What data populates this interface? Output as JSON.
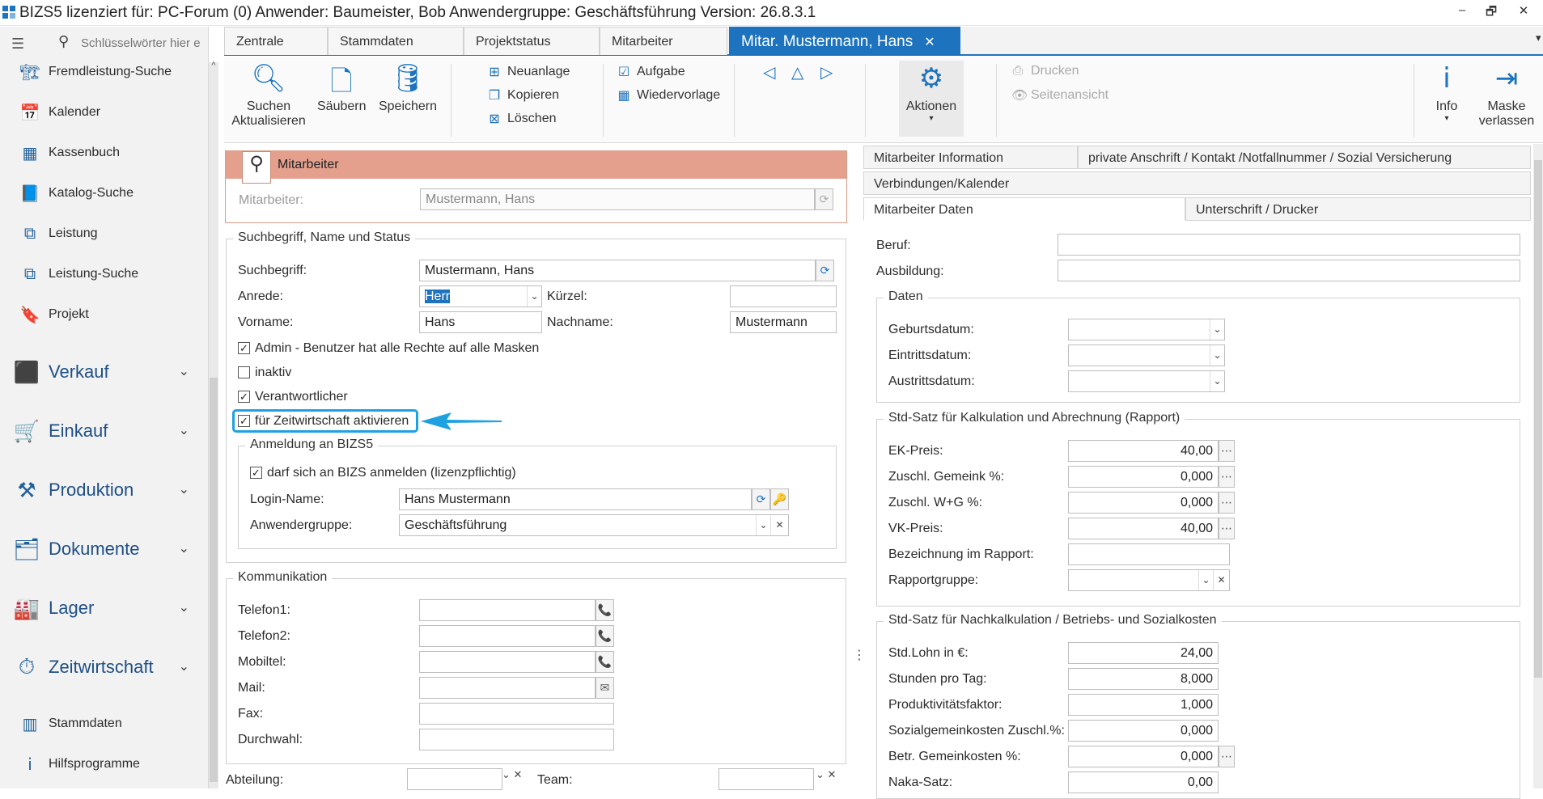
{
  "titlebar": {
    "text": "BIZS5  lizenziert für: PC-Forum (0)  Anwender: Baumeister, Bob  Anwendergruppe: Geschäftsführung   Version: 26.8.3.1"
  },
  "search": {
    "placeholder": "Schlüsselwörter hier e"
  },
  "sidebar": {
    "items": [
      {
        "label": "Fremdleistung-Suche",
        "icon": "crane-icon"
      },
      {
        "label": "Kalender",
        "icon": "calendar-icon"
      },
      {
        "label": "Kassenbuch",
        "icon": "cashbook-icon"
      },
      {
        "label": "Katalog-Suche",
        "icon": "catalog-icon"
      },
      {
        "label": "Leistung",
        "icon": "service-icon"
      },
      {
        "label": "Leistung-Suche",
        "icon": "service-search-icon"
      },
      {
        "label": "Projekt",
        "icon": "project-icon"
      }
    ],
    "groups": [
      {
        "label": "Verkauf"
      },
      {
        "label": "Einkauf"
      },
      {
        "label": "Produktion"
      },
      {
        "label": "Dokumente"
      },
      {
        "label": "Lager"
      },
      {
        "label": "Zeitwirtschaft"
      }
    ],
    "bottom": [
      {
        "label": "Stammdaten"
      },
      {
        "label": "Hilfsprogramme"
      }
    ]
  },
  "tabs": [
    {
      "label": "Zentrale"
    },
    {
      "label": "Stammdaten"
    },
    {
      "label": "Projektstatus"
    },
    {
      "label": "Mitarbeiter"
    },
    {
      "label": "Mitar. Mustermann, Hans"
    }
  ],
  "ribbon": {
    "suchen": "Suchen",
    "aktualisieren": "Aktualisieren",
    "saeubern": "Säubern",
    "speichern": "Speichern",
    "neuanlage": "Neuanlage",
    "kopieren": "Kopieren",
    "loeschen": "Löschen",
    "aufgabe": "Aufgabe",
    "wiedervorlage": "Wiedervorlage",
    "aktionen": "Aktionen",
    "drucken": "Drucken",
    "seitenansicht": "Seitenansicht",
    "info": "Info",
    "maske": "Maske",
    "verlassen": "verlassen"
  },
  "header": {
    "title": "Mitarbeiter",
    "mitarbeiter_label": "Mitarbeiter:",
    "mitarbeiter_value": "Mustermann, Hans"
  },
  "name_group": {
    "title": "Suchbegriff, Name und Status",
    "suchbegriff_label": "Suchbegriff:",
    "suchbegriff": "Mustermann, Hans",
    "anrede_label": "Anrede:",
    "anrede": "Herr",
    "kuerzel_label": "Kürzel:",
    "kuerzel": "",
    "vorname_label": "Vorname:",
    "vorname": "Hans",
    "nachname_label": "Nachname:",
    "nachname": "Mustermann",
    "cb_admin": "Admin - Benutzer hat alle Rechte auf alle Masken",
    "cb_inaktiv": "inaktiv",
    "cb_verantw": "Verantwortlicher",
    "cb_zeit": "für Zeitwirtschaft aktivieren"
  },
  "anmeldung": {
    "title": "Anmeldung an BIZS5",
    "cb_anmelden": "darf sich an BIZS anmelden (lizenzpflichtig)",
    "login_label": "Login-Name:",
    "login": "Hans Mustermann",
    "gruppe_label": "Anwendergruppe:",
    "gruppe": "Geschäftsführung"
  },
  "kommunikation": {
    "title": "Kommunikation",
    "telefon1": "Telefon1:",
    "telefon2": "Telefon2:",
    "mobil": "Mobiltel:",
    "mail": "Mail:",
    "fax": "Fax:",
    "durchwahl": "Durchwahl:"
  },
  "bottom": {
    "abteilung": "Abteilung:",
    "team": "Team:"
  },
  "right_tabs": {
    "info": "Mitarbeiter Information",
    "privat": "private Anschrift / Kontakt /Notfallnummer / Sozial Versicherung",
    "verbindungen": "Verbindungen/Kalender",
    "daten": "Mitarbeiter Daten",
    "unterschrift": "Unterschrift / Drucker"
  },
  "daten": {
    "beruf": "Beruf:",
    "ausbildung": "Ausbildung:",
    "group": "Daten",
    "geburt": "Geburtsdatum:",
    "eintritt": "Eintrittsdatum:",
    "austritt": "Austrittsdatum:"
  },
  "stdsatz": {
    "title": "Std-Satz für Kalkulation und Abrechnung (Rapport)",
    "ek_label": "EK-Preis:",
    "ek": "40,00",
    "gemein_label": "Zuschl. Gemeink %:",
    "gemein": "0,000",
    "wg_label": "Zuschl. W+G %:",
    "wg": "0,000",
    "vk_label": "VK-Preis:",
    "vk": "40,00",
    "bez_label": "Bezeichnung im Rapport:",
    "rg_label": "Rapportgruppe:"
  },
  "nachkalk": {
    "title": "Std-Satz für Nachkalkulation / Betriebs- und Sozialkosten",
    "lohn_label": "Std.Lohn in €:",
    "lohn": "24,00",
    "stunden_label": "Stunden pro Tag:",
    "stunden": "8,000",
    "prod_label": "Produktivitätsfaktor:",
    "prod": "1,000",
    "sozial_label": "Sozialgemeinkosten Zuschl.%:",
    "sozial": "0,000",
    "betr_label": "Betr. Gemeinkosten %:",
    "betr": "0,000",
    "naka_label": "Naka-Satz:",
    "naka": "0,00"
  },
  "colors": {
    "accent": "#1e73be",
    "header_bar": "#e4a08d",
    "highlight": "#1ea1e0"
  }
}
